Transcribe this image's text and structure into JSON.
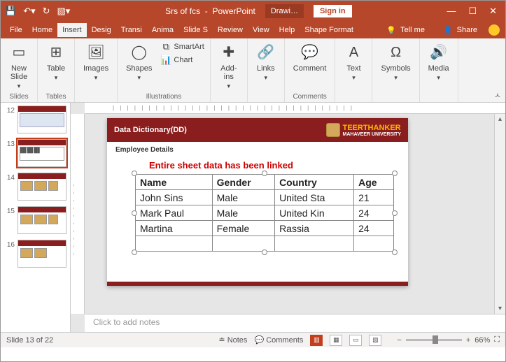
{
  "title_doc": "Srs of fcs",
  "title_app": "PowerPoint",
  "title_context": "Drawi…",
  "signin": "Sign in",
  "tabs": {
    "file": "File",
    "home": "Home",
    "insert": "Insert",
    "design": "Desig",
    "trans": "Transi",
    "anim": "Anima",
    "slideshow": "Slide S",
    "review": "Review",
    "view": "View",
    "help": "Help",
    "shapefmt": "Shape Format",
    "tellme": "Tell me",
    "share": "Share"
  },
  "ribbon": {
    "newslide": "New\nSlide",
    "table": "Table",
    "images": "Images",
    "shapes": "Shapes",
    "smartart": "SmartArt",
    "chart": "Chart",
    "addins": "Add-\nins",
    "links": "Links",
    "comment": "Comment",
    "text": "Text",
    "symbols": "Symbols",
    "media": "Media",
    "grp_slides": "Slides",
    "grp_tables": "Tables",
    "grp_illus": "Illustrations",
    "grp_comments": "Comments"
  },
  "thumbs": [
    "12",
    "13",
    "14",
    "15",
    "16"
  ],
  "slide": {
    "title": "Data Dictionary(DD)",
    "logo1": "TEERTHANKER",
    "logo2": "MAHAVEER UNIVERSITY",
    "subtitle": "Employee Details",
    "overlay": "Entire sheet data has been linked",
    "headers": [
      "Name",
      "Gender",
      "Country",
      "Age"
    ],
    "rows": [
      [
        "John Sins",
        "Male",
        "United Sta",
        "21"
      ],
      [
        "Mark Paul",
        "Male",
        "United Kin",
        "24"
      ],
      [
        "Martina",
        "Female",
        "Rassia",
        "24"
      ]
    ]
  },
  "notes_placeholder": "Click to add notes",
  "status": {
    "slide": "Slide 13 of 22",
    "notes": "Notes",
    "comments": "Comments",
    "zoom": "66%"
  }
}
